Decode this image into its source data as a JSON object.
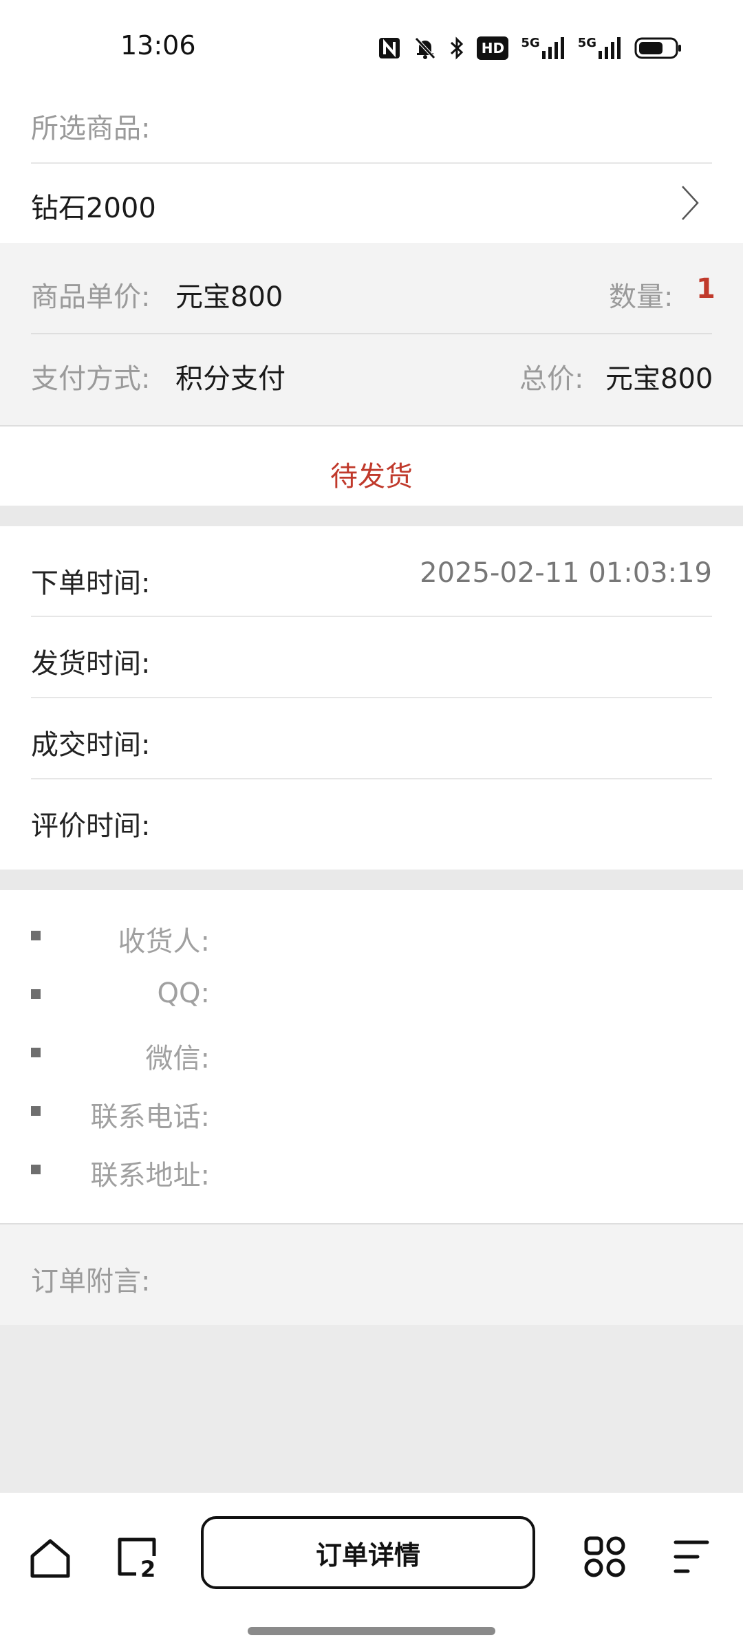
{
  "status_bar": {
    "time": "13:06",
    "hd_label": "HD",
    "signal1_label": "5G",
    "signal2_label": "5G"
  },
  "product": {
    "selected_label": "所选商品:",
    "name": "钻石2000"
  },
  "price_section": {
    "unit_price_label": "商品单价:",
    "unit_price_value": "元宝800",
    "quantity_label": "数量:",
    "quantity_value": "1",
    "payment_label": "支付方式:",
    "payment_value": "积分支付",
    "total_label": "总价:",
    "total_value": "元宝800"
  },
  "order_status": "待发货",
  "times": {
    "order_label": "下单时间:",
    "order_value": "2025-02-11 01:03:19",
    "ship_label": "发货时间:",
    "deal_label": "成交时间:",
    "review_label": "评价时间:"
  },
  "address": {
    "receiver_label": "收货人:",
    "qq_label": "QQ:",
    "wechat_label": "微信:",
    "phone_label": "联系电话:",
    "address_label": "联系地址:"
  },
  "remark_label": "订单附言:",
  "bottom_nav": {
    "tabs_count": "2",
    "detail_button": "订单详情"
  },
  "colors": {
    "accent_red": "#c0392b",
    "section_gray": "#f3f3f3",
    "divider_gray": "#e9e9e9"
  }
}
